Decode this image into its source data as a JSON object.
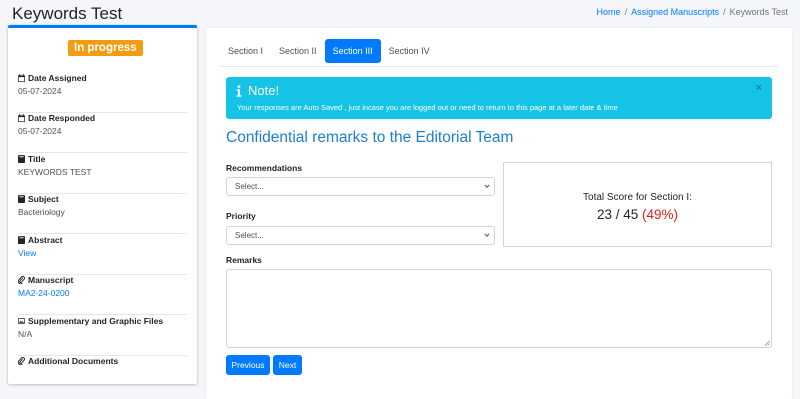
{
  "header": {
    "title": "Keywords Test",
    "breadcrumb": [
      "Home",
      "Assigned Manuscripts",
      "Keywords Test"
    ],
    "breadcrumb_separator": "/"
  },
  "sidebar": {
    "status": "In progress",
    "status_color": "#f39c12",
    "items": [
      {
        "label": "Date Assigned",
        "value": "05-07-2024",
        "icon": "calendar-icon",
        "link": false
      },
      {
        "label": "Date Responded",
        "value": "05-07-2024",
        "icon": "calendar-icon",
        "link": false
      },
      {
        "label": "Title",
        "value": "KEYWORDS TEST",
        "icon": "book-icon",
        "link": false
      },
      {
        "label": "Subject",
        "value": "Bacteriology",
        "icon": "book-icon",
        "link": false
      },
      {
        "label": "Abstract",
        "value": "View",
        "icon": "book-icon",
        "link": true
      },
      {
        "label": "Manuscript",
        "value": "MA2-24-0200",
        "icon": "paperclip-icon",
        "link": true
      },
      {
        "label": "Supplementary and Graphic Files",
        "value": "N/A",
        "icon": "image-icon",
        "link": false
      },
      {
        "label": "Additional Documents",
        "value": "",
        "icon": "paperclip-icon",
        "link": false
      }
    ]
  },
  "tabs": [
    {
      "label": "Section I",
      "active": false
    },
    {
      "label": "Section II",
      "active": false
    },
    {
      "label": "Section III",
      "active": true
    },
    {
      "label": "Section IV",
      "active": false
    }
  ],
  "alert": {
    "title": "Note!",
    "message": "Your responses are Auto Saved , just incase you are logged out or need to return to this page at a later date & time",
    "close": "×",
    "color": "#15c3e6"
  },
  "section": {
    "heading": "Confidential remarks to the Editorial Team",
    "recommendations_label": "Recommendations",
    "recommendations_value": "Select...",
    "priority_label": "Priority",
    "priority_value": "Select...",
    "remarks_label": "Remarks",
    "remarks_value": ""
  },
  "score": {
    "title": "Total Score for Section I:",
    "value": "23 / 45",
    "percent": "(49%)"
  },
  "buttons": {
    "previous": "Previous",
    "next": "Next"
  },
  "colors": {
    "primary": "#007bff",
    "heading": "#1b7fd6",
    "percent": "#e3211b"
  }
}
